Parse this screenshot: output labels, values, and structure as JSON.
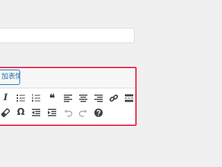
{
  "editor": {
    "media_button_label": "加表情"
  },
  "toolbar": {
    "row1": [
      {
        "name": "italic-button",
        "icon": "italic-icon",
        "glyph": "I"
      },
      {
        "name": "bullet-list-button",
        "icon": "bullet-list-icon"
      },
      {
        "name": "numbered-list-button",
        "icon": "numbered-list-icon"
      },
      {
        "name": "blockquote-button",
        "icon": "blockquote-icon",
        "glyph": "❝"
      },
      {
        "name": "align-left-button",
        "icon": "align-left-icon"
      },
      {
        "name": "align-center-button",
        "icon": "align-center-icon"
      },
      {
        "name": "align-right-button",
        "icon": "align-right-icon"
      },
      {
        "name": "insert-link-button",
        "icon": "link-icon"
      },
      {
        "name": "insert-more-button",
        "icon": "read-more-icon"
      }
    ],
    "row2": [
      {
        "name": "clear-formatting-button",
        "icon": "eraser-icon"
      },
      {
        "name": "special-character-button",
        "icon": "omega-icon",
        "glyph": "Ω"
      },
      {
        "name": "outdent-button",
        "icon": "outdent-icon"
      },
      {
        "name": "indent-button",
        "icon": "indent-icon"
      },
      {
        "name": "undo-button",
        "icon": "undo-icon"
      },
      {
        "name": "redo-button",
        "icon": "redo-icon"
      },
      {
        "name": "help-button",
        "icon": "help-icon"
      }
    ]
  },
  "colors": {
    "accent": "#2271b1",
    "highlight_border": "#e8304f",
    "icon": "#3c434a",
    "icon_disabled": "#a7aaad"
  }
}
